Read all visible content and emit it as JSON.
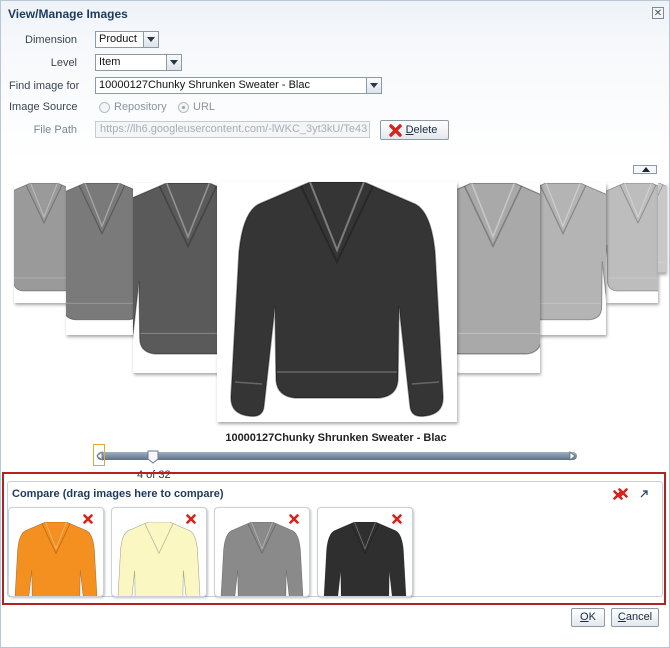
{
  "dialog": {
    "title": "View/Manage Images",
    "close_glyph": "✕"
  },
  "form": {
    "dimension": {
      "label": "Dimension",
      "value": "Product"
    },
    "level": {
      "label": "Level",
      "value": "Item"
    },
    "find_image": {
      "label": "Find image for",
      "value": "10000127Chunky Shrunken Sweater - Blac"
    },
    "image_source": {
      "label": "Image Source",
      "options": [
        "Repository",
        "URL"
      ],
      "selected": "URL"
    },
    "file_path": {
      "label": "File Path",
      "value": "https://lh6.googleusercontent.com/-lWKC_3yt3kU/Te43"
    },
    "delete_button": {
      "label_first": "D",
      "label_rest": "elete"
    }
  },
  "carousel": {
    "caption": "10000127Chunky Shrunken Sweater - Blac",
    "position": "4 of 32",
    "current_index": 4,
    "total": 32
  },
  "compare": {
    "title": "Compare (drag images here to compare)",
    "items": [
      {
        "color": "#f39020"
      },
      {
        "color": "#fbf7c2"
      },
      {
        "color": "#8a8a8a"
      },
      {
        "color": "#2f2f2f"
      }
    ]
  },
  "footer": {
    "ok": {
      "first": "O",
      "rest": "K"
    },
    "cancel": {
      "first": "C",
      "rest": "ancel"
    }
  },
  "colors": {
    "title": "#1d3a5c",
    "compare_border": "#b22222",
    "remove_icon": "#d8221c"
  }
}
